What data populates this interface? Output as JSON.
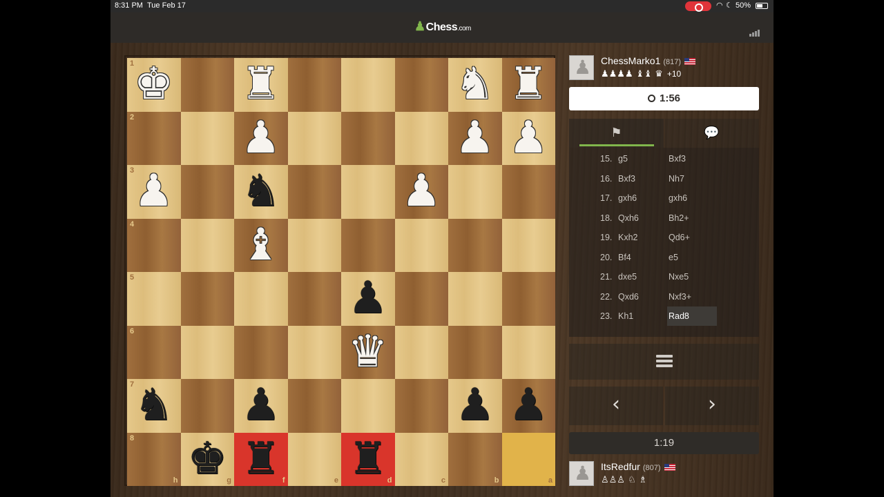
{
  "status_bar": {
    "time": "8:31 PM",
    "date": "Tue Feb 17",
    "battery": "50%"
  },
  "app": {
    "logo_text": "Chess",
    "logo_suffix": ".com"
  },
  "colors": {
    "accent_green": "#81b64c",
    "last_move_red": "#d9352b",
    "highlight_yellow": "#e1b34a"
  },
  "board": {
    "orientation": "black-bottom",
    "ranks": [
      "1",
      "2",
      "3",
      "4",
      "5",
      "6",
      "7",
      "8"
    ],
    "files": [
      "h",
      "g",
      "f",
      "e",
      "d",
      "c",
      "b",
      "a"
    ],
    "squares": [
      [
        "wK",
        "",
        "wR",
        "",
        "",
        "",
        "wN",
        "wR"
      ],
      [
        "",
        "",
        "wP",
        "",
        "",
        "",
        "wP",
        "wP"
      ],
      [
        "wP",
        "",
        "bN",
        "",
        "",
        "wP",
        "",
        ""
      ],
      [
        "",
        "",
        "wB",
        "",
        "",
        "",
        "",
        ""
      ],
      [
        "",
        "",
        "",
        "",
        "bP",
        "",
        "",
        ""
      ],
      [
        "",
        "",
        "",
        "",
        "wQ",
        "",
        "",
        ""
      ],
      [
        "bN",
        "",
        "bP",
        "",
        "",
        "",
        "bP",
        "bP"
      ],
      [
        "",
        "bK",
        "bR",
        "",
        "bR",
        "",
        "",
        ""
      ]
    ],
    "highlights": {
      "7-2": "red",
      "7-4": "red",
      "7-7": "yellow"
    }
  },
  "opponent": {
    "name": "ChessMarko1",
    "rating": "(817)",
    "captured": "♟♟♟♟ ♝♝ ♛",
    "advantage": "+10",
    "clock": "1:56"
  },
  "player": {
    "name": "ItsRedfur",
    "rating": "(807)",
    "captured": "♙♙♙ ♘ ♗",
    "clock": "1:19"
  },
  "tabs": [
    {
      "name": "moves",
      "icon": "pawn-flag-icon"
    },
    {
      "name": "chat",
      "icon": "chat-bubbles-icon"
    }
  ],
  "moves": [
    {
      "n": "15.",
      "w": "g5",
      "b": "Bxf3"
    },
    {
      "n": "16.",
      "w": "Bxf3",
      "b": "Nh7"
    },
    {
      "n": "17.",
      "w": "gxh6",
      "b": "gxh6"
    },
    {
      "n": "18.",
      "w": "Qxh6",
      "b": "Bh2+"
    },
    {
      "n": "19.",
      "w": "Kxh2",
      "b": "Qd6+"
    },
    {
      "n": "20.",
      "w": "Bf4",
      "b": "e5"
    },
    {
      "n": "21.",
      "w": "dxe5",
      "b": "Nxe5"
    },
    {
      "n": "22.",
      "w": "Qxd6",
      "b": "Nxf3+"
    },
    {
      "n": "23.",
      "w": "Kh1",
      "b": "Rad8"
    }
  ],
  "controls": {
    "prev": "‹",
    "next": "›"
  }
}
